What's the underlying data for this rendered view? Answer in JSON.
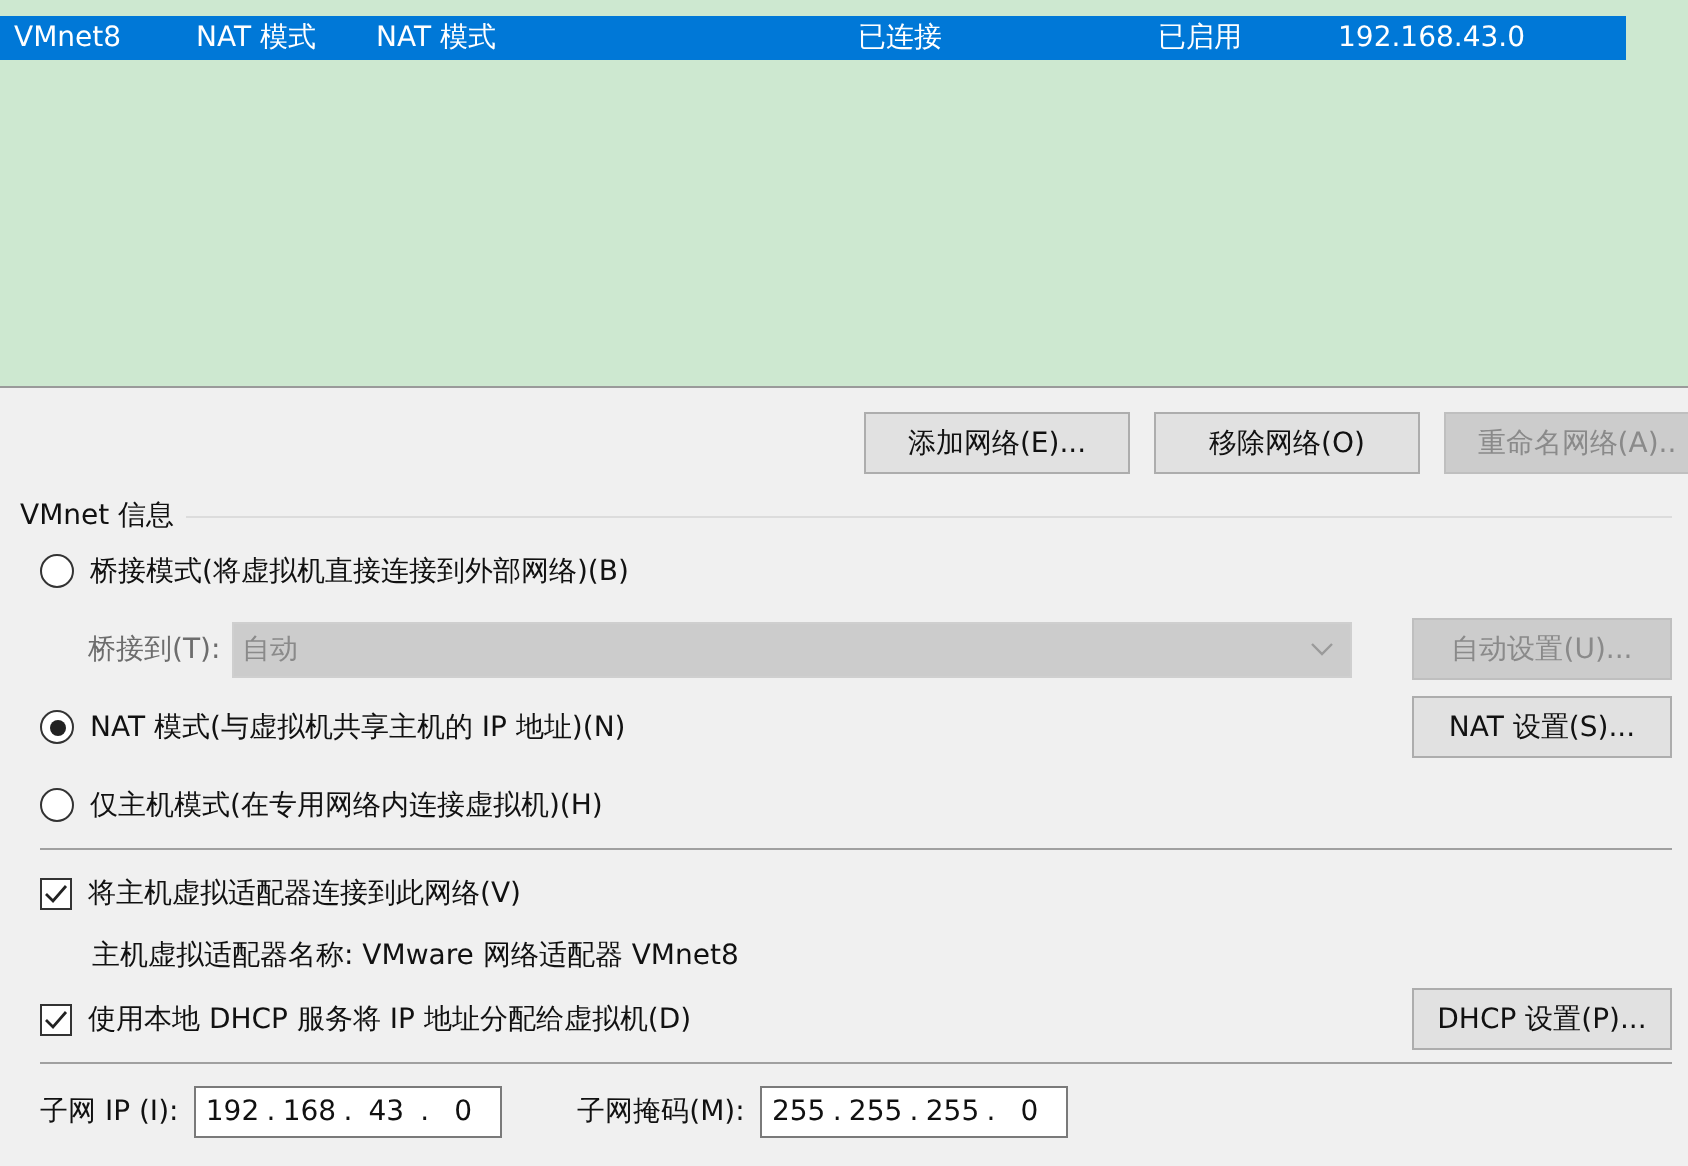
{
  "networks": {
    "rows": [
      {
        "cells": [
          "VMnet8",
          "NAT 模式",
          "NAT 模式",
          "已连接",
          "已启用",
          "192.168.43.0"
        ],
        "selected": true
      }
    ]
  },
  "buttons": [
    {
      "label": "添加网络(E)...",
      "disabled": false
    },
    {
      "label": "移除网络(O)",
      "disabled": false
    },
    {
      "label": "重命名网络(A)..",
      "disabled": true
    }
  ],
  "group": {
    "title": "VMnet 信息",
    "modes": [
      {
        "label": "桥接模式(将虚拟机直接连接到外部网络)(B)",
        "selected": false
      },
      {
        "label": "NAT 模式(与虚拟机共享主机的 IP 地址)(N)",
        "selected": true
      },
      {
        "label": "仅主机模式(在专用网络内连接虚拟机)(H)",
        "selected": false
      }
    ],
    "bridge_to": {
      "label": "桥接到(T):",
      "value": "自动",
      "disabled": true
    },
    "auto_button": {
      "label": "自动设置(U)...",
      "disabled": true
    },
    "nat_button": {
      "label": "NAT 设置(S)...",
      "disabled": false
    },
    "connect_adapter": {
      "label": "将主机虚拟适配器连接到此网络(V)",
      "checked": true
    },
    "adapter_name": "主机虚拟适配器名称: VMware 网络适配器 VMnet8",
    "dhcp": {
      "label": "使用本地 DHCP 服务将 IP 地址分配给虚拟机(D)",
      "checked": true
    },
    "dhcp_button": {
      "label": "DHCP 设置(P)...",
      "disabled": false
    },
    "subnet_ip": {
      "label": "子网 IP (I):",
      "octets": [
        "192",
        "168",
        "43",
        "0"
      ],
      "separator": "."
    },
    "subnet_mask": {
      "label": "子网掩码(M):",
      "octets": [
        "255",
        "255",
        "255",
        "0"
      ],
      "separator": "."
    }
  }
}
